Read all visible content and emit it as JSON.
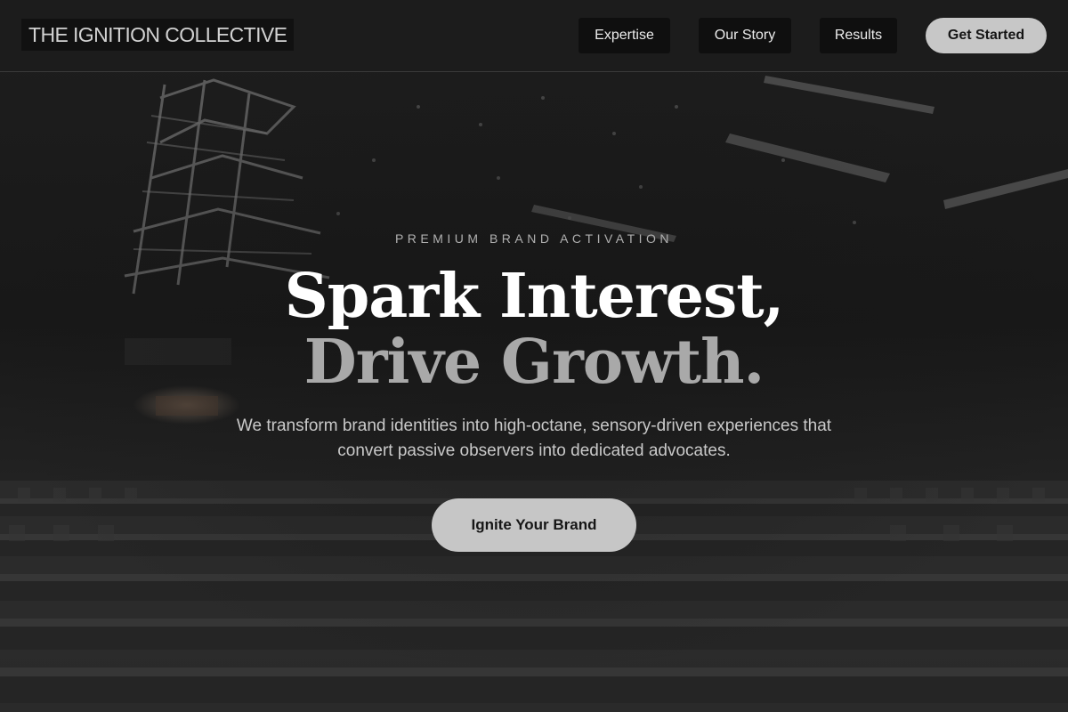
{
  "navbar": {
    "logo": "THE IGNITION COLLECTIVE",
    "links": [
      "Expertise",
      "Our Story",
      "Results"
    ],
    "cta": "Get Started"
  },
  "hero": {
    "eyebrow": "PREMIUM BRAND ACTIVATION",
    "headline_line1": "Spark Interest,",
    "headline_line2": "Drive Growth.",
    "subtext": "We transform brand identities into high-octane, sensory-driven experiences that convert passive observers into dedicated advocates.",
    "cta": "Ignite Your Brand",
    "background_image": "dark-event-hall-photo"
  },
  "colors": {
    "background": "#1c1c1c",
    "nav_button_bg": "#0f0f0f",
    "cta_bg": "#c7c7c7",
    "headline_primary": "#ffffff",
    "headline_secondary": "#a9a9a9"
  }
}
